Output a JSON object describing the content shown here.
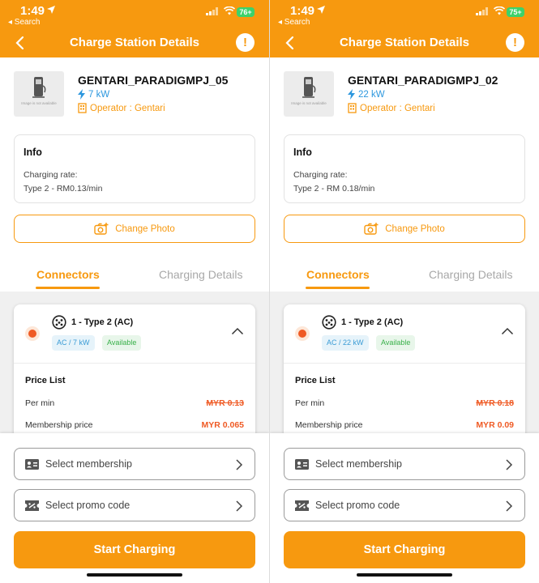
{
  "screens": [
    {
      "status": {
        "time": "1:49",
        "back_app": "◂ Search",
        "battery": "76+"
      },
      "header": {
        "title": "Charge Station Details",
        "alert_glyph": "!"
      },
      "station": {
        "name": "GENTARI_PARADIGMPJ_05",
        "power": "7 kW",
        "operator": "Operator : Gentari",
        "image_placeholder": "Image is not available"
      },
      "info": {
        "title": "Info",
        "rate_label": "Charging rate:",
        "rate_value": "Type 2 - RM0.13/min"
      },
      "change_photo": "Change Photo",
      "tabs": {
        "connectors": "Connectors",
        "charging_details": "Charging Details"
      },
      "connector": {
        "title": "1 - Type 2 (AC)",
        "spec": "AC / 7 kW",
        "status": "Available",
        "price_list": "Price List",
        "per_min_label": "Per min",
        "per_min_value": "MYR 0.13",
        "membership_label": "Membership price",
        "membership_value": "MYR 0.065"
      },
      "bottom": {
        "membership": "Select membership",
        "promo": "Select promo code",
        "start": "Start Charging"
      }
    },
    {
      "status": {
        "time": "1:49",
        "back_app": "◂ Search",
        "battery": "75+"
      },
      "header": {
        "title": "Charge Station Details",
        "alert_glyph": "!"
      },
      "station": {
        "name": "GENTARI_PARADIGMPJ_02",
        "power": "22 kW",
        "operator": "Operator : Gentari",
        "image_placeholder": "Image is not available"
      },
      "info": {
        "title": "Info",
        "rate_label": "Charging rate:",
        "rate_value": "Type 2 - RM 0.18/min"
      },
      "change_photo": "Change Photo",
      "tabs": {
        "connectors": "Connectors",
        "charging_details": "Charging Details"
      },
      "connector": {
        "title": "1 - Type 2 (AC)",
        "spec": "AC / 22 kW",
        "status": "Available",
        "price_list": "Price List",
        "per_min_label": "Per min",
        "per_min_value": "MYR 0.18",
        "membership_label": "Membership price",
        "membership_value": "MYR 0.09"
      },
      "bottom": {
        "membership": "Select membership",
        "promo": "Select promo code",
        "start": "Start Charging"
      }
    }
  ],
  "colors": {
    "accent": "#f7990f",
    "radio": "#ef5a24",
    "power_blue": "#2c97de",
    "available_green": "#38b049"
  },
  "icons": [
    "location-arrow-icon",
    "signal-icon",
    "wifi-icon",
    "battery-icon",
    "back-chevron-icon",
    "alert-icon",
    "charger-icon",
    "lightning-icon",
    "building-icon",
    "camera-plus-icon",
    "type2-plug-icon",
    "chevron-up-icon",
    "id-card-icon",
    "ticket-icon",
    "chevron-right-icon"
  ]
}
